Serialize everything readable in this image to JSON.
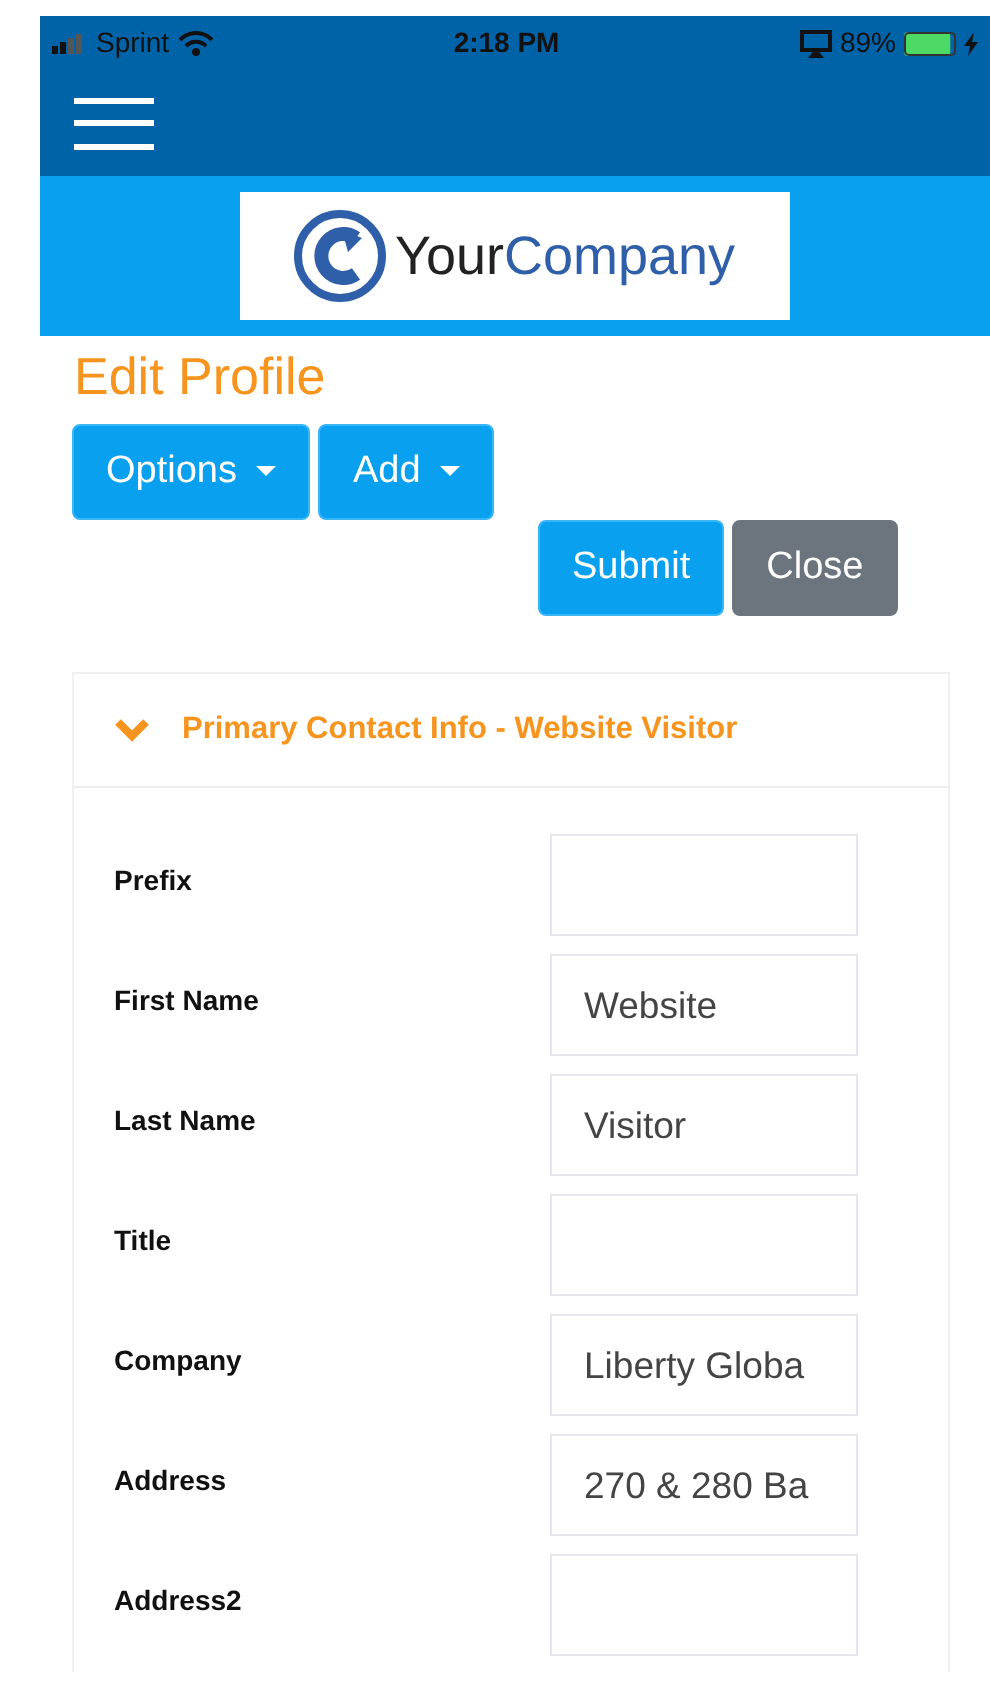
{
  "status_bar": {
    "carrier": "Sprint",
    "time": "2:18 PM",
    "battery_text": "89%",
    "battery": {
      "level": 0.89,
      "charging": true
    }
  },
  "logo": {
    "word_1": "Your",
    "word_2": "Company"
  },
  "page_title": "Edit Profile",
  "dropdowns": [
    {
      "label": "Options"
    },
    {
      "label": "Add"
    }
  ],
  "actions": [
    {
      "label": "Submit",
      "kind": "primary"
    },
    {
      "label": "Close",
      "kind": "secondary"
    }
  ],
  "section": {
    "title": "Primary Contact Info - Website Visitor",
    "expanded": true,
    "fields": [
      {
        "label": "Prefix"
      },
      {
        "label": "First Name",
        "value": "Website"
      },
      {
        "label": "Last Name",
        "value": "Visitor"
      },
      {
        "label": "Title"
      },
      {
        "label": "Company",
        "value": "Liberty Globa"
      },
      {
        "label": "Address",
        "value": "270 & 280 Ba"
      },
      {
        "label": "Address2"
      }
    ]
  }
}
